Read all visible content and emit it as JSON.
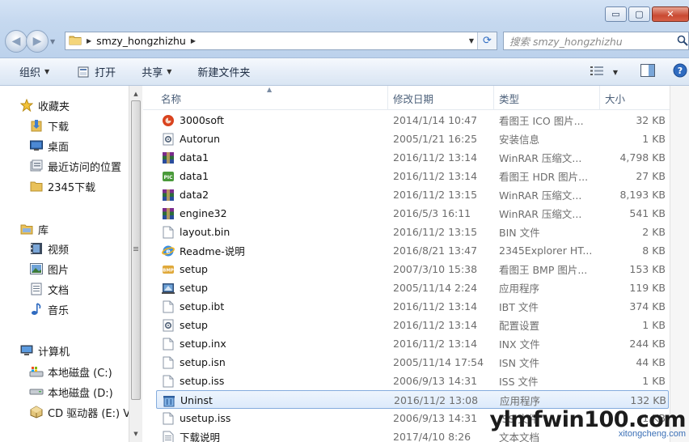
{
  "window": {
    "minimize_glyph": "▭",
    "maximize_glyph": "▢",
    "close_glyph": "✕"
  },
  "address": {
    "breadcrumb": [
      "smzy_hongzhizhu"
    ]
  },
  "search": {
    "placeholder": "搜索 smzy_hongzhizhu"
  },
  "toolbar": {
    "organize": "组织",
    "open": "打开",
    "share": "共享",
    "new_folder": "新建文件夹"
  },
  "nav": {
    "favorites": "收藏夹",
    "downloads": "下载",
    "desktop": "桌面",
    "recent": "最近访问的位置",
    "folder_2345": "2345下载",
    "libraries": "库",
    "videos": "视频",
    "pictures": "图片",
    "documents": "文档",
    "music": "音乐",
    "computer": "计算机",
    "drive_c": "本地磁盘 (C:)",
    "drive_d": "本地磁盘 (D:)",
    "drive_e": "CD 驱动器 (E:) V"
  },
  "columns": {
    "name": "名称",
    "date": "修改日期",
    "type": "类型",
    "size": "大小"
  },
  "files": [
    {
      "name": "3000soft",
      "date": "2014/1/14 10:47",
      "type": "看图王 ICO 图片...",
      "size": "32 KB",
      "icon": "ico-image-icon"
    },
    {
      "name": "Autorun",
      "date": "2005/1/21 16:25",
      "type": "安装信息",
      "size": "1 KB",
      "icon": "settings-file-icon"
    },
    {
      "name": "data1",
      "date": "2016/11/2 13:14",
      "type": "WinRAR 压缩文...",
      "size": "4,798 KB",
      "icon": "winrar-archive-icon"
    },
    {
      "name": "data1",
      "date": "2016/11/2 13:14",
      "type": "看图王 HDR 图片...",
      "size": "27 KB",
      "icon": "hdr-image-icon"
    },
    {
      "name": "data2",
      "date": "2016/11/2 13:15",
      "type": "WinRAR 压缩文...",
      "size": "8,193 KB",
      "icon": "winrar-archive-icon"
    },
    {
      "name": "engine32",
      "date": "2016/5/3 16:11",
      "type": "WinRAR 压缩文...",
      "size": "541 KB",
      "icon": "winrar-archive-icon"
    },
    {
      "name": "layout.bin",
      "date": "2016/11/2 13:15",
      "type": "BIN 文件",
      "size": "2 KB",
      "icon": "blank-file-icon"
    },
    {
      "name": "Readme-说明",
      "date": "2016/8/21 13:47",
      "type": "2345Explorer HT...",
      "size": "8 KB",
      "icon": "html-browser-icon"
    },
    {
      "name": "setup",
      "date": "2007/3/10 15:38",
      "type": "看图王 BMP 图片...",
      "size": "153 KB",
      "icon": "bmp-image-icon"
    },
    {
      "name": "setup",
      "date": "2005/11/14 2:24",
      "type": "应用程序",
      "size": "119 KB",
      "icon": "installer-app-icon"
    },
    {
      "name": "setup.ibt",
      "date": "2016/11/2 13:14",
      "type": "IBT 文件",
      "size": "374 KB",
      "icon": "blank-file-icon"
    },
    {
      "name": "setup",
      "date": "2016/11/2 13:14",
      "type": "配置设置",
      "size": "1 KB",
      "icon": "settings-file-icon"
    },
    {
      "name": "setup.inx",
      "date": "2016/11/2 13:14",
      "type": "INX 文件",
      "size": "244 KB",
      "icon": "blank-file-icon"
    },
    {
      "name": "setup.isn",
      "date": "2005/11/14 17:54",
      "type": "ISN 文件",
      "size": "44 KB",
      "icon": "blank-file-icon"
    },
    {
      "name": "setup.iss",
      "date": "2006/9/13 14:31",
      "type": "ISS 文件",
      "size": "1 KB",
      "icon": "blank-file-icon"
    },
    {
      "name": "Uninst",
      "date": "2016/11/2 13:08",
      "type": "应用程序",
      "size": "132 KB",
      "icon": "uninstall-app-icon",
      "selected": true
    },
    {
      "name": "usetup.iss",
      "date": "2006/9/13 14:31",
      "type": "ISS 文件",
      "size": "1 KB",
      "icon": "blank-file-icon"
    },
    {
      "name": "下载说明",
      "date": "2017/4/10 8:26",
      "type": "文本文档",
      "size": "",
      "icon": "text-file-icon"
    }
  ],
  "watermark": {
    "main": "ylmfwin100.com",
    "sub": "xitongcheng.com"
  },
  "colors": {
    "selection_border": "#84acdd",
    "selection_fill": "#dceafb",
    "titlebar": "#c5d8ef"
  }
}
